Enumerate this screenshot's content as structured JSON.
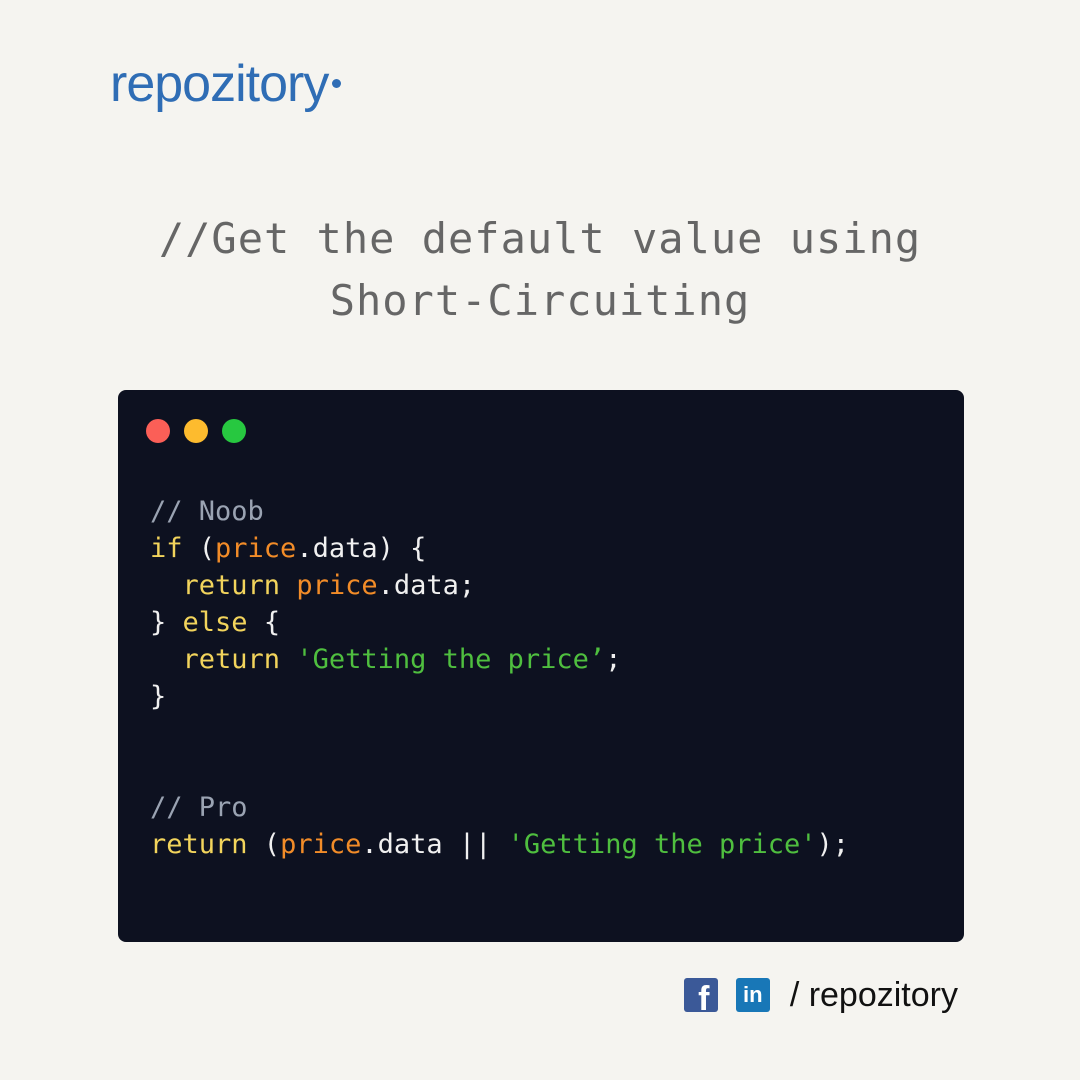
{
  "brand": {
    "name": "repozitory",
    "color": "#2f6db5"
  },
  "headline": {
    "line1": "//Get the default value using",
    "line2": "Short-Circuiting"
  },
  "window_controls": [
    "close",
    "minimize",
    "maximize"
  ],
  "code": {
    "noob_comment": "// Noob",
    "if_kw": "if",
    "if_open": " (",
    "price_var": "price",
    "data_close_brace": ".data) {",
    "indent": "  ",
    "return_kw": "return",
    "space": " ",
    "data_semicolon": ".data;",
    "close_brace": "}",
    "else_kw": "else",
    "open_brace": " {",
    "getting_price_string": "'Getting the price’",
    "semicolon": ";",
    "pro_comment": "// Pro",
    "return_open": " (",
    "data_or": ".data || ",
    "pro_string": "'Getting the price'",
    "pro_end": ");"
  },
  "social": {
    "icons": [
      "facebook-icon",
      "linkedin-icon"
    ],
    "facebook_glyph": "f",
    "linkedin_glyph": "in",
    "handle": "/ repozitory"
  },
  "colors": {
    "background": "#f5f4f0",
    "code_background": "#0d1120",
    "keyword": "#f2d45c",
    "variable": "#f28c28",
    "string": "#4fbf3f",
    "comment": "#9aa3b2"
  }
}
